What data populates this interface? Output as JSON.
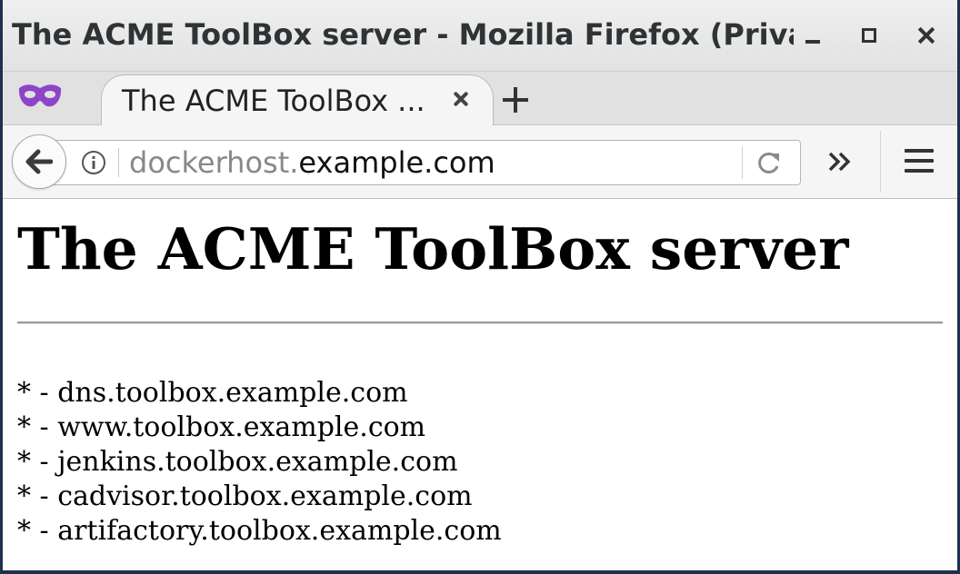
{
  "window": {
    "title": "The ACME ToolBox server - Mozilla Firefox (Priva..."
  },
  "tabs": [
    {
      "label": "The ACME ToolBox ...",
      "active": true
    }
  ],
  "icons": {
    "private_browsing": "private-browsing-mask-icon",
    "back": "arrow-left-icon",
    "info": "info-circle-icon",
    "reload": "reload-icon",
    "overflow": "double-chevron-right-icon",
    "menu": "hamburger-menu-icon",
    "tab_close": "close-icon",
    "new_tab": "plus-icon"
  },
  "urlbar": {
    "host_prefix": "dockerhost.",
    "domain": "example.com"
  },
  "page": {
    "heading": "The ACME ToolBox server",
    "bullet_prefix": "* - ",
    "items": [
      "dns.toolbox.example.com",
      "www.toolbox.example.com",
      "jenkins.toolbox.example.com",
      "cadvisor.toolbox.example.com",
      "artifactory.toolbox.example.com"
    ]
  },
  "colors": {
    "private_mask": "#8e44c7",
    "desktop_border": "#1e3050"
  }
}
